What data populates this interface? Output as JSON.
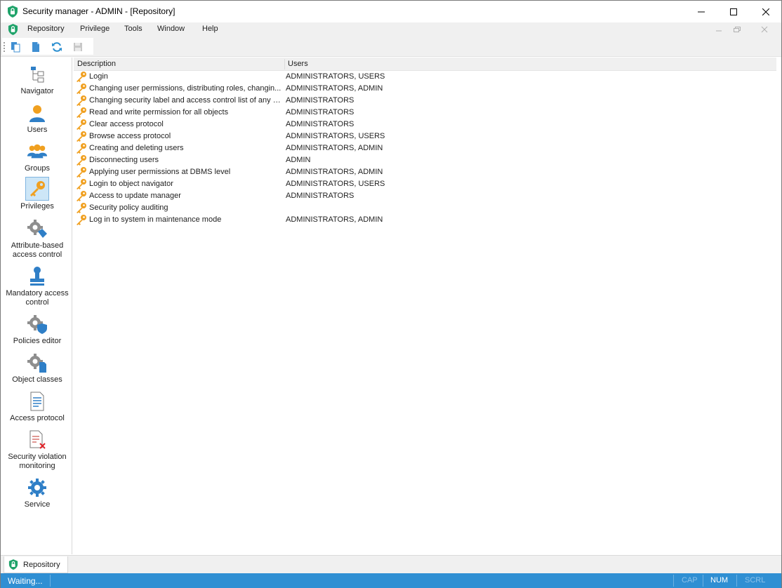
{
  "window": {
    "title": "Security manager - ADMIN - [Repository]"
  },
  "menu": {
    "items": [
      "Repository",
      "Privilege",
      "Tools",
      "Window",
      "Help"
    ]
  },
  "sidebar": {
    "items": [
      {
        "label": "Navigator",
        "icon": "navigator-icon"
      },
      {
        "label": "Users",
        "icon": "user-icon"
      },
      {
        "label": "Groups",
        "icon": "groups-icon"
      },
      {
        "label": "Privileges",
        "icon": "key-icon",
        "active": true
      },
      {
        "label": "Attribute-based access control",
        "icon": "gear-tag-icon"
      },
      {
        "label": "Mandatory access control",
        "icon": "stamp-icon"
      },
      {
        "label": "Policies editor",
        "icon": "gear-shield-icon"
      },
      {
        "label": "Object classes",
        "icon": "gear-document-icon"
      },
      {
        "label": "Access protocol",
        "icon": "log-document-icon"
      },
      {
        "label": "Security violation monitoring",
        "icon": "violation-document-icon"
      },
      {
        "label": "Service",
        "icon": "gear-icon"
      }
    ]
  },
  "grid": {
    "columns": [
      "Description",
      "Users"
    ],
    "rows": [
      {
        "description": "Login",
        "users": "ADMINISTRATORS, USERS"
      },
      {
        "description": "Changing user permissions, distributing roles, changin...",
        "users": "ADMINISTRATORS, ADMIN"
      },
      {
        "description": "Changing security label and access control list of any o...",
        "users": "ADMINISTRATORS"
      },
      {
        "description": "Read and write permission for all objects",
        "users": "ADMINISTRATORS"
      },
      {
        "description": "Clear access protocol",
        "users": "ADMINISTRATORS"
      },
      {
        "description": "Browse access protocol",
        "users": "ADMINISTRATORS, USERS"
      },
      {
        "description": "Creating and deleting users",
        "users": "ADMINISTRATORS, ADMIN"
      },
      {
        "description": "Disconnecting users",
        "users": "ADMIN"
      },
      {
        "description": "Applying user permissions at DBMS level",
        "users": "ADMINISTRATORS, ADMIN"
      },
      {
        "description": "Login to object navigator",
        "users": "ADMINISTRATORS, USERS"
      },
      {
        "description": "Access to update manager",
        "users": "ADMINISTRATORS"
      },
      {
        "description": "Security policy auditing",
        "users": ""
      },
      {
        "description": "Log in to system in maintenance mode",
        "users": "ADMINISTRATORS, ADMIN"
      }
    ]
  },
  "tabs": {
    "repository_label": "Repository"
  },
  "status": {
    "text": "Waiting...",
    "cap": "CAP",
    "num": "NUM",
    "scrl": "SCRL"
  },
  "colors": {
    "accent": "#2f8fd3",
    "key": "#f0a020",
    "shield": "#1fa36a"
  }
}
